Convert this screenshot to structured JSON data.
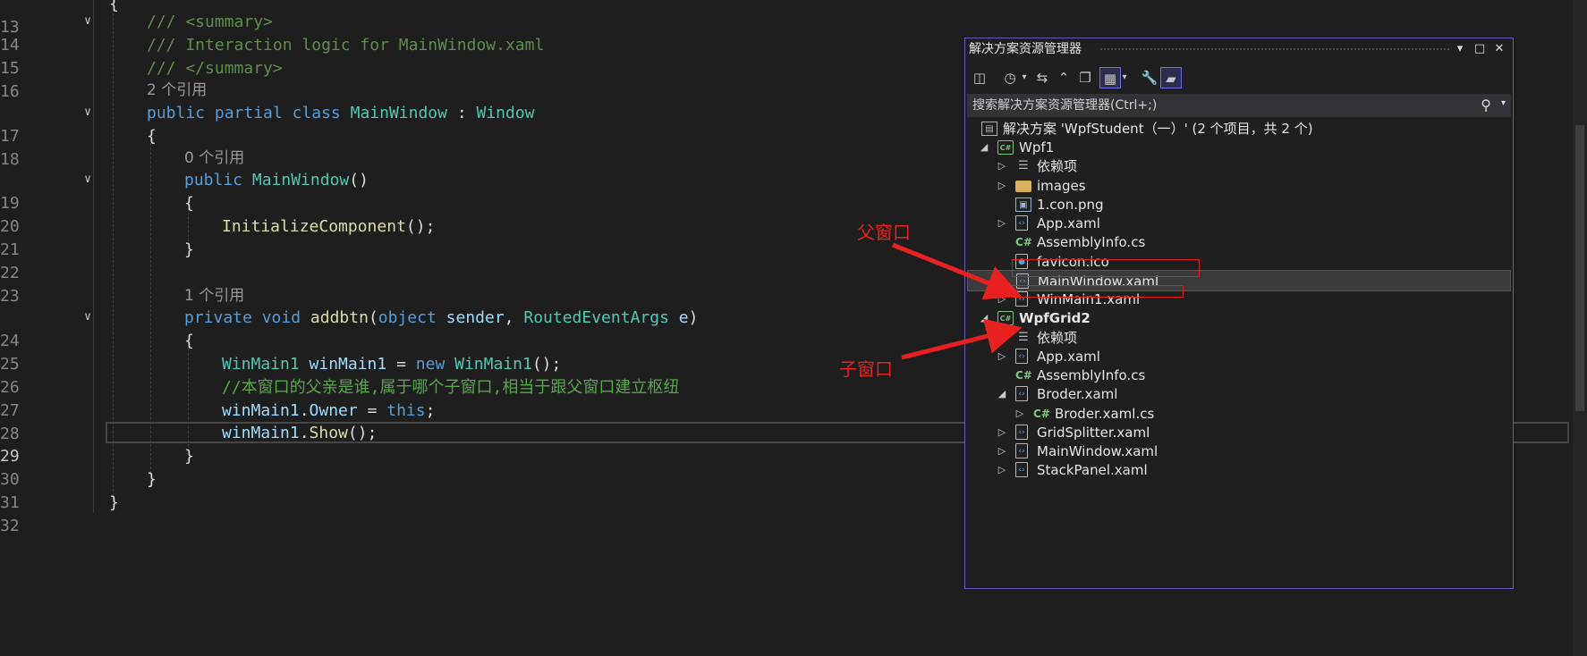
{
  "editor": {
    "line_numbers": [
      "13",
      "14",
      "15",
      "16",
      "17",
      "18",
      "19",
      "20",
      "21",
      "22",
      "23",
      "24",
      "25",
      "26",
      "27",
      "28",
      "29",
      "30",
      "31",
      "32"
    ],
    "active_line": "29",
    "top_brace": "{",
    "summary_open": "/// <summary>",
    "summary_text": "/// Interaction logic for MainWindow.xaml",
    "summary_close": "/// </summary>",
    "refs_class": "2 个引用",
    "class_kw1": "public",
    "class_kw2": "partial",
    "class_kw3": "class",
    "class_name": "MainWindow",
    "class_colon": " : ",
    "class_base": "Window",
    "brace_open": "{",
    "brace_close": "}",
    "refs_ctor": "0 个引用",
    "ctor_kw": "public",
    "ctor_name": "MainWindow",
    "ctor_parens": "()",
    "init_call": "InitializeComponent",
    "init_tail": "();",
    "refs_method": "1 个引用",
    "m_kw1": "private",
    "m_kw2": "void",
    "m_name": "addbtn",
    "m_p1": "(",
    "m_kw3": "object",
    "m_sender": " sender",
    "m_comma": ", ",
    "m_type": "RoutedEventArgs",
    "m_e": " e",
    "m_close": ")",
    "s1_type": "WinMain1",
    "s1_var": " winMain1",
    "s1_eq": " = ",
    "s1_new": "new",
    "s1_ctor": " WinMain1",
    "s1_end": "();",
    "s2_comment": "//本窗口的父亲是谁,属于哪个子窗口,相当于跟父窗口建立枢纽",
    "s3_var": "winMain1",
    "s3_dot": ".",
    "s3_prop": "Owner",
    "s3_eq": " = ",
    "s3_this": "this",
    "s3_end": ";",
    "s4_var": "winMain1",
    "s4_dot": ".",
    "s4_fn": "Show",
    "s4_end": "();"
  },
  "solution_explorer": {
    "title": "解决方案资源管理器",
    "search_placeholder": "搜索解决方案资源管理器(Ctrl+;)",
    "solution_label": "解决方案 'WpfStudent（一）' (2 个项目，共 2 个)",
    "items": [
      {
        "label": "Wpf1",
        "icon": "csharp-project-icon"
      },
      {
        "label": "依赖项",
        "icon": "dependencies-icon"
      },
      {
        "label": "images",
        "icon": "folder-icon"
      },
      {
        "label": "1.con.png",
        "icon": "image-file-icon"
      },
      {
        "label": "App.xaml",
        "icon": "xaml-file-icon"
      },
      {
        "label": "AssemblyInfo.cs",
        "icon": "csharp-file-icon"
      },
      {
        "label": "favicon.ico",
        "icon": "ico-file-icon"
      },
      {
        "label": "MainWindow.xaml",
        "icon": "xaml-file-icon"
      },
      {
        "label": "WinMain1.xaml",
        "icon": "xaml-file-icon"
      },
      {
        "label": "WpfGrid2",
        "icon": "csharp-project-icon"
      },
      {
        "label": "依赖项",
        "icon": "dependencies-icon"
      },
      {
        "label": "App.xaml",
        "icon": "xaml-file-icon"
      },
      {
        "label": "AssemblyInfo.cs",
        "icon": "csharp-file-icon"
      },
      {
        "label": "Broder.xaml",
        "icon": "xaml-file-icon"
      },
      {
        "label": "Broder.xaml.cs",
        "icon": "csharp-file-icon"
      },
      {
        "label": "GridSplitter.xaml",
        "icon": "xaml-file-icon"
      },
      {
        "label": "MainWindow.xaml",
        "icon": "xaml-file-icon"
      },
      {
        "label": "StackPanel.xaml",
        "icon": "xaml-file-icon"
      }
    ]
  },
  "annotations": {
    "parent_label": "父窗口",
    "child_label": "子窗口",
    "color": "#e82020"
  },
  "colors": {
    "background": "#1e1e1e",
    "panel_border": "#6159b5",
    "keyword": "#569cd6",
    "type": "#4ec9b0",
    "method": "#dcdcaa",
    "comment": "#57a64a"
  }
}
